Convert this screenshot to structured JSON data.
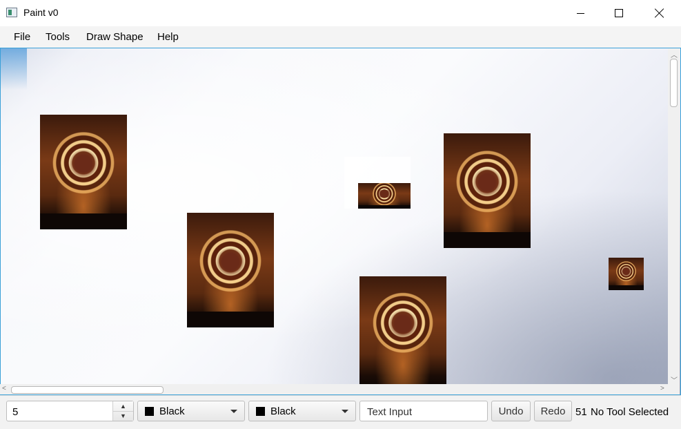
{
  "window": {
    "title": "Paint v0"
  },
  "menu": {
    "items": [
      "File",
      "Tools",
      "Draw Shape",
      "Help"
    ]
  },
  "toolbar": {
    "brush_size": "5",
    "stroke_color": "Black",
    "fill_color": "Black",
    "text_input_placeholder": "Text Input",
    "undo_label": "Undo",
    "redo_label": "Redo",
    "counter": "51",
    "status": "No Tool Selected"
  },
  "colors": {
    "accent": "#3aa0d8",
    "swatch": "#000000"
  }
}
